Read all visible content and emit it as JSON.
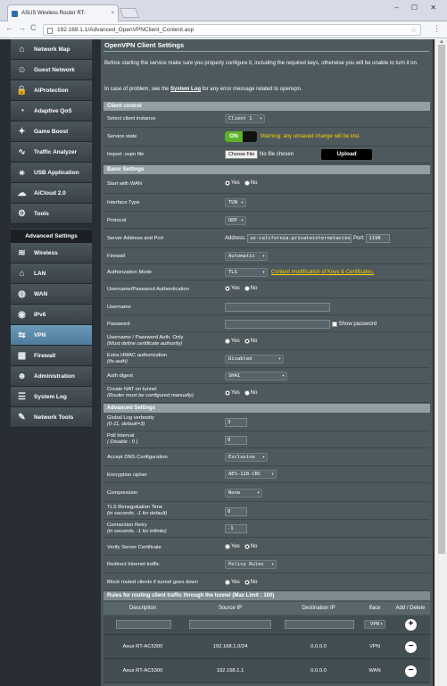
{
  "browser": {
    "tab_title": "ASUS Wireless Router RT-",
    "tab_close": "×",
    "window_controls": "–  ☐  ✕",
    "url": "192.168.1.1/Advanced_OpenVPNClient_Content.asp",
    "nav_back": "←",
    "nav_forward": "→",
    "nav_reload": "C",
    "menu": "⋮",
    "bookmark": "☆"
  },
  "sidebar": {
    "items": [
      {
        "label": "Network Map",
        "icon": "network-map-icon"
      },
      {
        "label": "Guest Network",
        "icon": "guest-network-icon"
      },
      {
        "label": "AiProtection",
        "icon": "aiprotection-icon"
      },
      {
        "label": "Adaptive QoS",
        "icon": "qos-icon"
      },
      {
        "label": "Game Boost",
        "icon": "game-boost-icon"
      },
      {
        "label": "Traffic Analyzer",
        "icon": "traffic-analyzer-icon"
      },
      {
        "label": "USB Application",
        "icon": "usb-icon"
      },
      {
        "label": "AiCloud 2.0",
        "icon": "aicloud-icon"
      },
      {
        "label": "Tools",
        "icon": "tools-icon"
      }
    ],
    "advanced_header": "Advanced Settings",
    "advanced_items": [
      {
        "label": "Wireless",
        "icon": "wireless-icon"
      },
      {
        "label": "LAN",
        "icon": "lan-icon"
      },
      {
        "label": "WAN",
        "icon": "wan-icon"
      },
      {
        "label": "IPv6",
        "icon": "ipv6-icon"
      },
      {
        "label": "VPN",
        "icon": "vpn-icon",
        "active": true
      },
      {
        "label": "Firewall",
        "icon": "firewall-icon"
      },
      {
        "label": "Administration",
        "icon": "administration-icon"
      },
      {
        "label": "System Log",
        "icon": "system-log-icon"
      },
      {
        "label": "Network Tools",
        "icon": "network-tools-icon"
      }
    ]
  },
  "main": {
    "title": "OpenVPN Client Settings",
    "intro": "Before starting the service make sure you properly configure it, including the required keys, otherwise you will be unable to turn it on.",
    "caution_pre": "In case of problem, see the",
    "caution_link": "System Log",
    "caution_post": "for any error message related to openvpn.",
    "client_control": {
      "header": "Client control",
      "select_instance_label": "Select client instance",
      "select_instance_value": "Client 1",
      "service_state_label": "Service state",
      "service_state_value": "ON",
      "service_state_warning": "Warning: any unsaved change will be lost.",
      "import_label": "Import .ovpn file",
      "choose_file": "Choose File",
      "no_file": "No file chosen",
      "upload": "Upload"
    },
    "basic": {
      "header": "Basic Settings",
      "start_wan_label": "Start with WAN",
      "yes": "Yes",
      "no": "No",
      "interface_label": "Interface Type",
      "interface_value": "TUN",
      "protocol_label": "Protocol",
      "protocol_value": "UDP",
      "server_label": "Server Address and Port",
      "address_label": "Address:",
      "address_value": "us-california.privateinternetaccess.com",
      "port_label": "Port:",
      "port_value": "1198",
      "firewall_label": "Firewall",
      "firewall_value": "Automatic",
      "auth_mode_label": "Authorization Mode",
      "auth_mode_value": "TLS",
      "auth_mode_link": "Content modification of Keys & Certificates.",
      "userpass_label": "Username/Password Authentication",
      "username_label": "Username",
      "username_value": "",
      "password_label": "Password",
      "password_value": "",
      "show_password": "Show password",
      "userpass_only_label": "Username / Password Auth. Only",
      "userpass_only_note": "(Must define certificate authority)",
      "hmac_label": "Extra HMAC authorization",
      "hmac_note": "(tls-auth)",
      "hmac_value": "Disabled",
      "digest_label": "Auth digest",
      "digest_value": "SHA1",
      "nat_label": "Create NAT on tunnel",
      "nat_note": "(Router must be configured manually)"
    },
    "advanced": {
      "header": "Advanced Settings",
      "verbosity_label": "Global Log verbosity",
      "verbosity_note": "(0-11, default=3)",
      "verbosity_value": "3",
      "poll_label": "Poll Interval",
      "poll_note": "( Disable : 0 )",
      "poll_value": "0",
      "dns_label": "Accept DNS Configuration",
      "dns_value": "Exclusive",
      "cipher_label": "Encryption cipher",
      "cipher_value": "AES-128-CBC",
      "compression_label": "Compression",
      "compression_value": "None",
      "tls_reneg_label": "TLS Renegotiation Time",
      "tls_reneg_note": "(in seconds, -1 for default)",
      "tls_reneg_value": "0",
      "retry_label": "Connection Retry",
      "retry_note": "(in seconds, -1 for infinite)",
      "retry_value": "-1",
      "verify_label": "Verify Server Certificate",
      "redirect_label": "Redirect Internet traffic",
      "redirect_value": "Policy Rules",
      "block_label": "Block routed clients if tunnel goes down"
    },
    "rules": {
      "header": "Rules for routing client traffic through the tunnel (Max Limit : 100)",
      "columns": [
        "Description",
        "Source IP",
        "Destination IP",
        "Iface",
        "Add / Delete"
      ],
      "new_iface": "VPN",
      "rows": [
        {
          "description": "Asus RT-AC5300",
          "source": "192.168.1.0/24",
          "destination": "0.0.0.0",
          "iface": "VPN"
        },
        {
          "description": "Asus RT-AC5300",
          "source": "192.168.1.1",
          "destination": "0.0.0.0",
          "iface": "WAN"
        }
      ]
    }
  }
}
